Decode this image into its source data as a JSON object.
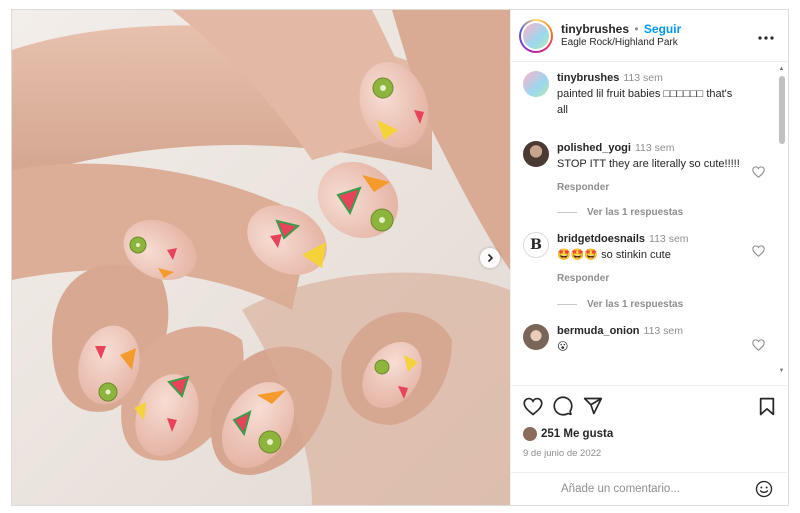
{
  "post": {
    "username": "tinybrushes",
    "separator": "•",
    "follow_label": "Seguir",
    "location": "Eagle Rock/Highland Park",
    "more_icon": "more-options-icon",
    "next_icon": "chevron-right-icon",
    "image_icon": "nail-art-photo"
  },
  "caption": {
    "username": "tinybrushes",
    "time": "113 sem",
    "text": "painted lil fruit babies □□□□□□ that's all"
  },
  "comments": [
    {
      "username": "polished_yogi",
      "time": "113 sem",
      "text": "STOP ITT they are literally so cute!!!!!",
      "reply_label": "Responder",
      "view_replies": "Ver las 1 respuestas"
    },
    {
      "username": "bridgetdoesnails",
      "time": "113 sem",
      "text": "🤩🤩🤩 so stinkin cute",
      "reply_label": "Responder",
      "view_replies": "Ver las 1 respuestas"
    },
    {
      "username": "bermuda_onion",
      "time": "113 sem",
      "text": "😮"
    }
  ],
  "actions": {
    "likes": "251 Me gusta",
    "date": "9 de junio de 2022",
    "icons": [
      "heart-icon",
      "comment-icon",
      "share-icon",
      "bookmark-icon"
    ]
  },
  "add_comment": {
    "placeholder": "Añade un comentario...",
    "emoji_icon": "emoji-icon"
  },
  "colors": {
    "link_blue": "#0095f6",
    "muted_gray": "#8e8e8e",
    "border": "#dbdbdb"
  }
}
